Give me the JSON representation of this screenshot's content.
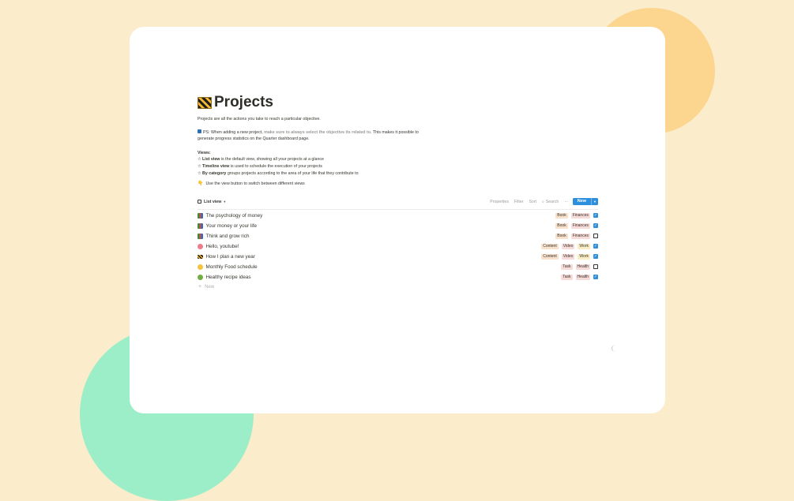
{
  "colors": {
    "background": "#fbeccb",
    "accent": "#2e8fdc",
    "blob_orange": "#fcd58e",
    "blob_green": "#9ceec8"
  },
  "page": {
    "icon": "construction-icon",
    "title": "Projects"
  },
  "description": {
    "intro": "Projects are all the actions you take to reach a particular objective.",
    "ps_prefix": "PS: When adding a new project, ",
    "ps_highlight": "make sure to always select the objective its related to",
    "ps_suffix": ". This makes it possible to generate progress statistics on the Quarter dashboard page.",
    "views_label": "Views:",
    "views": [
      {
        "name": "List view",
        "desc": " is the default view, showing all your projects at a glance"
      },
      {
        "name": "Timeline view",
        "desc": " is used to schedule the execution of your projects"
      },
      {
        "name": "By category",
        "desc": " groups projects according to the area of your life that they contribute to"
      }
    ],
    "hint": "Use the view button to switch between different views"
  },
  "toolbar": {
    "view_label": "List view",
    "properties": "Properties",
    "filter": "Filter",
    "sort": "Sort",
    "search": "Search",
    "more": "···",
    "new_label": "New"
  },
  "rows": [
    {
      "title": "The psychology of money",
      "icon": "books-icon",
      "tags": [
        {
          "text": "Book",
          "color": "orange"
        },
        {
          "text": "Finances",
          "color": "red"
        }
      ],
      "done": true
    },
    {
      "title": "Your money or your life",
      "icon": "books-icon",
      "tags": [
        {
          "text": "Book",
          "color": "orange"
        },
        {
          "text": "Finances",
          "color": "red"
        }
      ],
      "done": true
    },
    {
      "title": "Think and grow rich",
      "icon": "books-icon",
      "tags": [
        {
          "text": "Book",
          "color": "orange"
        },
        {
          "text": "Finances",
          "color": "red"
        }
      ],
      "done": false
    },
    {
      "title": "Hello, youtube!",
      "icon": "heart-icon",
      "tags": [
        {
          "text": "Content",
          "color": "orange"
        },
        {
          "text": "Video",
          "color": "red"
        },
        {
          "text": "Work",
          "color": "yellow"
        }
      ],
      "done": true
    },
    {
      "title": "How I plan a new year",
      "icon": "construction-icon",
      "tags": [
        {
          "text": "Content",
          "color": "orange"
        },
        {
          "text": "Video",
          "color": "red"
        },
        {
          "text": "Work",
          "color": "yellow"
        }
      ],
      "done": true
    },
    {
      "title": "Monthly Food schedule",
      "icon": "smile-icon",
      "tags": [
        {
          "text": "Task",
          "color": "red"
        },
        {
          "text": "Health",
          "color": "red"
        }
      ],
      "done": false
    },
    {
      "title": "Healthy recipe ideas",
      "icon": "salad-icon",
      "tags": [
        {
          "text": "Task",
          "color": "red"
        },
        {
          "text": "Health",
          "color": "red"
        }
      ],
      "done": true
    }
  ],
  "add_row_label": "New"
}
